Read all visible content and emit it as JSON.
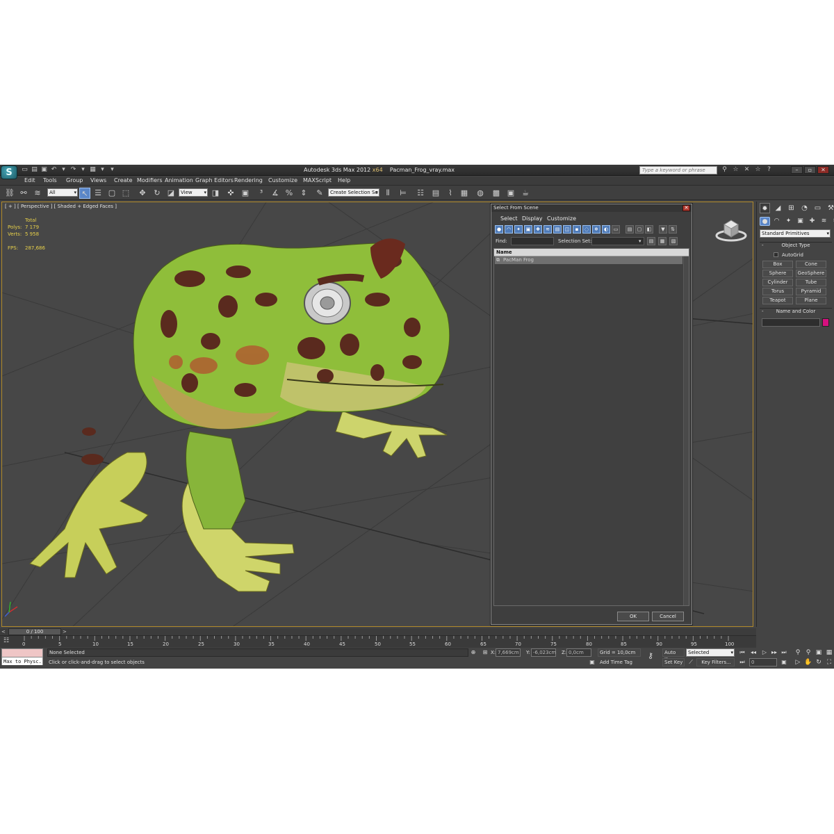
{
  "window": {
    "app_logo": "S",
    "title_app": "Autodesk 3ds Max  2012",
    "title_ver": "x64",
    "title_file": "Pacman_Frog_vray.max",
    "search_placeholder": "Type a keyword or phrase",
    "quick_access": [
      "new-file-icon",
      "open-icon",
      "save-icon",
      "undo-icon",
      "redo-icon",
      "project-icon"
    ],
    "title_icons": [
      "binoculars-icon",
      "star-icon",
      "key-icon",
      "help-icon"
    ]
  },
  "menus": [
    "Edit",
    "Tools",
    "Group",
    "Views",
    "Create",
    "Modifiers",
    "Animation",
    "Graph Editors",
    "Rendering",
    "Customize",
    "MAXScript",
    "Help"
  ],
  "toolbar": {
    "selection_filter": "All",
    "ref_coord": "View",
    "named_selection": "Create Selection Se"
  },
  "viewport": {
    "label": "[ + ] [ Perspective ] [ Shaded + Edged Faces ]",
    "stats_header": "Total",
    "polys_label": "Polys:",
    "polys_value": "7 179",
    "verts_label": "Verts:",
    "verts_value": "5 958",
    "fps_label": "FPS:",
    "fps_value": "287,686"
  },
  "dialog": {
    "title": "Select From Scene",
    "menu": [
      "Select",
      "Display",
      "Customize"
    ],
    "find_label": "Find:",
    "selection_set_label": "Selection Set:",
    "column_name": "Name",
    "rows": [
      "PacMan Frog"
    ],
    "ok_label": "OK",
    "cancel_label": "Cancel"
  },
  "command_panel": {
    "primitive_dropdown": "Standard Primitives",
    "object_type_label": "Object Type",
    "autogrid_label": "AutoGrid",
    "primitives": [
      "Box",
      "Cone",
      "Sphere",
      "GeoSphere",
      "Cylinder",
      "Tube",
      "Torus",
      "Pyramid",
      "Teapot",
      "Plane"
    ],
    "name_color_label": "Name and Color",
    "object_color": "#d6107f"
  },
  "timeline": {
    "slider_label": "0 / 100",
    "ticks": [
      "0",
      "5",
      "10",
      "15",
      "20",
      "25",
      "30",
      "35",
      "40",
      "45",
      "50",
      "55",
      "60",
      "65",
      "70",
      "75",
      "80",
      "85",
      "90",
      "95",
      "100"
    ]
  },
  "status": {
    "maxscript_text": "Max to Physc.",
    "selection_status": "None Selected",
    "prompt": "Click or click-and-drag to select objects",
    "x_label": "X:",
    "x_value": "7,669cm",
    "y_label": "Y:",
    "y_value": "-6,023cm",
    "z_label": "Z:",
    "z_value": "0,0cm",
    "grid": "Grid = 10,0cm",
    "add_time_tag": "Add Time Tag",
    "auto_key": "Auto Key",
    "set_key": "Set Key",
    "key_mode": "Selected",
    "key_filters": "Key Filters...",
    "frame_value": "0"
  }
}
